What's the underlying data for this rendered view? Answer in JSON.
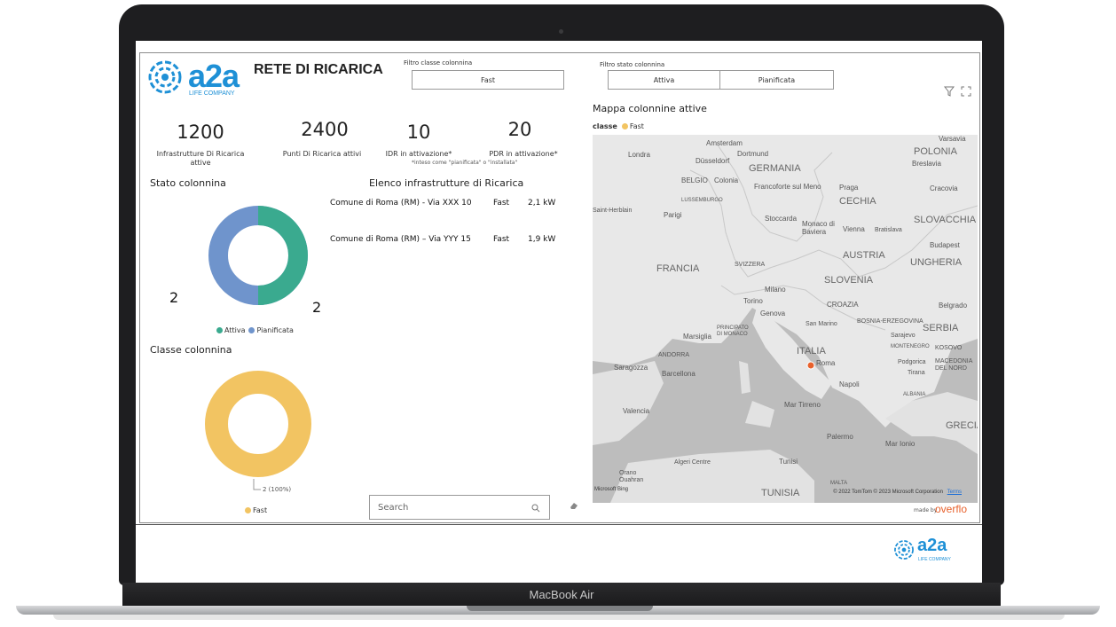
{
  "device": {
    "model_label": "MacBook Air"
  },
  "header": {
    "logo_text": "a2a",
    "logo_sub": "LIFE COMPANY",
    "title": "RETE DI RICARICA"
  },
  "filters": {
    "class_label": "Filtro classe colonnina",
    "class_options": [
      "Fast"
    ],
    "state_label": "Filtro stato colonnina",
    "state_options": [
      "Attiva",
      "Pianificata"
    ]
  },
  "kpis": [
    {
      "value": "1200",
      "label": "Infrastrutture Di Ricarica attive"
    },
    {
      "value": "2400",
      "label": "Punti Di Ricarica attivi"
    },
    {
      "value": "10",
      "label": "IDR in attivazione*"
    },
    {
      "value": "20",
      "label": "PDR in attivazione*"
    }
  ],
  "kpi_note": "*inteso come \"pianificata\" o \"installata\"",
  "stato_chart": {
    "title": "Stato colonnina",
    "label_left": "2",
    "label_right": "2",
    "legend": [
      {
        "name": "Attiva",
        "color": "#3aaa8f"
      },
      {
        "name": "Pianificata",
        "color": "#6f94cc"
      }
    ]
  },
  "classe_chart": {
    "title": "Classe colonnina",
    "data_label": "2 (100%)",
    "legend": [
      {
        "name": "Fast",
        "color": "#f2c462"
      }
    ]
  },
  "list": {
    "title": "Elenco infrastrutture di Ricarica",
    "rows": [
      {
        "address": "Comune di Roma (RM) - Via XXX 10",
        "class": "Fast",
        "power": "2,1 kW"
      },
      {
        "address": "Comune di Roma (RM) – Via YYY 15",
        "class": "Fast",
        "power": "1,9 kW"
      }
    ]
  },
  "search": {
    "placeholder": "Search"
  },
  "map": {
    "title": "Mappa colonnine attive",
    "legend_label": "classe",
    "legend_item": "Fast",
    "attribution": "© 2022 TomTom  © 2023 Microsoft Corporation",
    "terms": "Terms",
    "bing": "Microsoft Bing",
    "labels": {
      "amsterdam": "Amsterdam",
      "london": "Londra",
      "dusseldorf": "Düsseldorf",
      "dortmund": "Dortmund",
      "germania": "GERMANIA",
      "belgio": "BELGIO",
      "colonia": "Colonia",
      "lussemburgo": "LUSSEMBURGO",
      "francoforte": "Francoforte sul Meno",
      "praga": "Praga",
      "cechia": "CECHIA",
      "polonia": "POLONIA",
      "varsavia": "Varsavia",
      "breslavia": "Breslavia",
      "cracovia": "Cracovia",
      "parigi": "Parigi",
      "stoccarda": "Stoccarda",
      "monaco": "Monaco di Baviera",
      "vienna": "Vienna",
      "bratislava": "Bratislava",
      "slovacchia": "SLOVACCHIA",
      "budapest": "Budapest",
      "ungheria": "UNGHERIA",
      "austria": "AUSTRIA",
      "francia": "FRANCIA",
      "svizzera": "SVIZZERA",
      "slovenia": "SLOVENIA",
      "milano": "Milano",
      "torino": "Torino",
      "croazia": "CROAZIA",
      "genova": "Genova",
      "bosnia": "BOSNIA-ERZEGOVINA",
      "belgrado": "Belgrado",
      "sanmarino": "San Marino",
      "serbia": "SERBIA",
      "principato": "PRINCIPATO DI MONACO",
      "marsiglia": "Marsiglia",
      "montenegro": "MONTENEGRO",
      "kosovo": "KOSOVO",
      "italia": "ITALIA",
      "andorra": "ANDORRA",
      "roma": "Roma",
      "podgorica": "Podgorica",
      "tirana": "Tirana",
      "macedonia": "MACEDONIA DEL NORD",
      "saragozza": "Saragozza",
      "barcellona": "Barcellona",
      "napoli": "Napoli",
      "albania": "ALBANIA",
      "valencia": "Valencia",
      "tirreno": "Mar Tirreno",
      "grecia": "GRECIA",
      "palermo": "Palermo",
      "ionio": "Mar Ionio",
      "algeri": "Algeri Centre",
      "tunisi": "Tunisi",
      "orano": "Orano",
      "ouahran": "Ouahran",
      "malta": "MALTA",
      "tunisia": "TUNISIA",
      "sarajevo": "Sarajevo",
      "saintherblain": "Saint-Herblain"
    }
  },
  "credit": {
    "prefix": "made by",
    "brand": "overflo"
  },
  "footer": {
    "logo_text": "a2a",
    "logo_sub": "LIFE COMPANY"
  }
}
